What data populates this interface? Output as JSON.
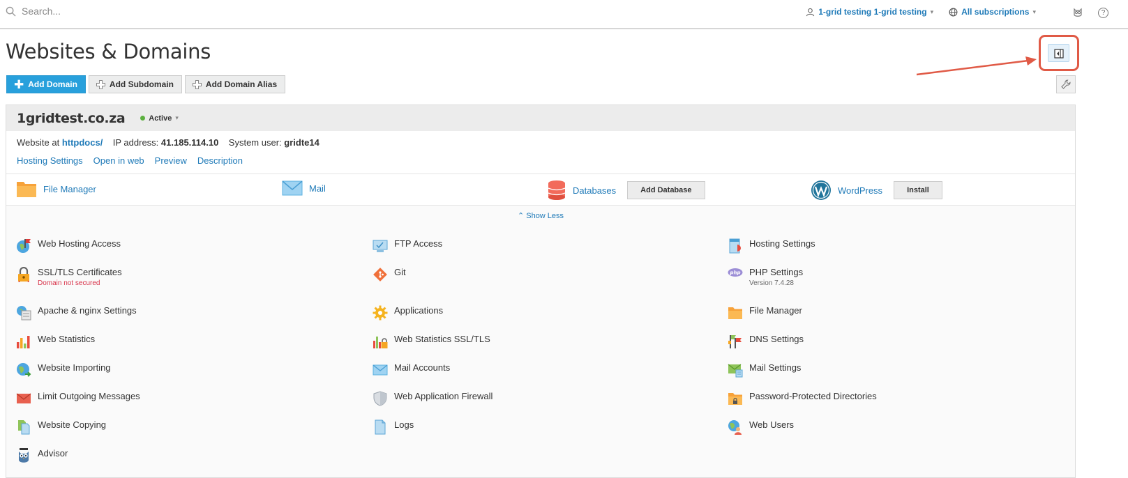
{
  "topbar": {
    "search_placeholder": "Search...",
    "user_label": "1-grid testing 1-grid testing",
    "subscriptions_label": "All subscriptions",
    "help_label": "?"
  },
  "page_title": "Websites & Domains",
  "toolbar": {
    "add_domain": "Add Domain",
    "add_subdomain": "Add Subdomain",
    "add_domain_alias": "Add Domain Alias"
  },
  "domain": {
    "name": "1gridtest.co.za",
    "status": "Active",
    "website_at_label": "Website at",
    "website_at_value": "httpdocs/",
    "ip_label": "IP address:",
    "ip_value": "41.185.114.10",
    "system_user_label": "System user:",
    "system_user_value": "gridte14",
    "links": [
      "Hosting Settings",
      "Open in web",
      "Preview",
      "Description"
    ]
  },
  "quick": {
    "file_manager": "File Manager",
    "mail": "Mail",
    "databases": "Databases",
    "add_database": "Add Database",
    "wordpress": "WordPress",
    "install": "Install"
  },
  "show_less": "Show Less",
  "tools": [
    {
      "label": "Web Hosting Access",
      "icon": "globe-flag-icon"
    },
    {
      "label": "FTP Access",
      "icon": "ftp-monitor-icon"
    },
    {
      "label": "Hosting Settings",
      "icon": "hosting-settings-icon"
    },
    {
      "label": "SSL/TLS Certificates",
      "sub": "Domain not secured",
      "icon": "lock-icon"
    },
    {
      "label": "Git",
      "icon": "git-icon"
    },
    {
      "label": "PHP Settings",
      "sub": "Version 7.4.28",
      "icon": "php-icon"
    },
    {
      "label": "Apache & nginx Settings",
      "icon": "apache-server-icon"
    },
    {
      "label": "Applications",
      "icon": "gear-icon"
    },
    {
      "label": "File Manager",
      "icon": "folder-icon"
    },
    {
      "label": "Web Statistics",
      "icon": "bar-chart-icon"
    },
    {
      "label": "Web Statistics SSL/TLS",
      "icon": "bar-chart-lock-icon"
    },
    {
      "label": "DNS Settings",
      "icon": "dns-flags-icon"
    },
    {
      "label": "Website Importing",
      "icon": "globe-import-icon"
    },
    {
      "label": "Mail Accounts",
      "icon": "envelope-icon"
    },
    {
      "label": "Mail Settings",
      "icon": "mail-settings-icon"
    },
    {
      "label": "Limit Outgoing Messages",
      "icon": "envelope-limit-icon"
    },
    {
      "label": "Web Application Firewall",
      "icon": "shield-icon"
    },
    {
      "label": "Password-Protected Directories",
      "icon": "folder-lock-icon"
    },
    {
      "label": "Website Copying",
      "icon": "copy-pages-icon"
    },
    {
      "label": "Logs",
      "icon": "log-file-icon"
    },
    {
      "label": "Web Users",
      "icon": "web-user-icon"
    },
    {
      "label": "Advisor",
      "icon": "owl-icon"
    }
  ]
}
